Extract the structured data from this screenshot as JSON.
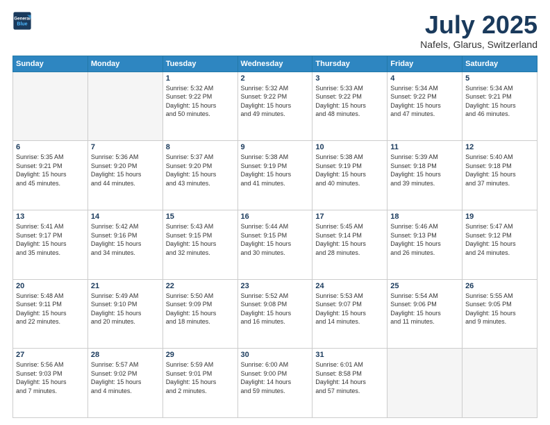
{
  "header": {
    "logo_line1": "General",
    "logo_line2": "Blue",
    "month": "July 2025",
    "location": "Nafels, Glarus, Switzerland"
  },
  "days_of_week": [
    "Sunday",
    "Monday",
    "Tuesday",
    "Wednesday",
    "Thursday",
    "Friday",
    "Saturday"
  ],
  "weeks": [
    [
      {
        "day": "",
        "info": ""
      },
      {
        "day": "",
        "info": ""
      },
      {
        "day": "1",
        "info": "Sunrise: 5:32 AM\nSunset: 9:22 PM\nDaylight: 15 hours\nand 50 minutes."
      },
      {
        "day": "2",
        "info": "Sunrise: 5:32 AM\nSunset: 9:22 PM\nDaylight: 15 hours\nand 49 minutes."
      },
      {
        "day": "3",
        "info": "Sunrise: 5:33 AM\nSunset: 9:22 PM\nDaylight: 15 hours\nand 48 minutes."
      },
      {
        "day": "4",
        "info": "Sunrise: 5:34 AM\nSunset: 9:22 PM\nDaylight: 15 hours\nand 47 minutes."
      },
      {
        "day": "5",
        "info": "Sunrise: 5:34 AM\nSunset: 9:21 PM\nDaylight: 15 hours\nand 46 minutes."
      }
    ],
    [
      {
        "day": "6",
        "info": "Sunrise: 5:35 AM\nSunset: 9:21 PM\nDaylight: 15 hours\nand 45 minutes."
      },
      {
        "day": "7",
        "info": "Sunrise: 5:36 AM\nSunset: 9:20 PM\nDaylight: 15 hours\nand 44 minutes."
      },
      {
        "day": "8",
        "info": "Sunrise: 5:37 AM\nSunset: 9:20 PM\nDaylight: 15 hours\nand 43 minutes."
      },
      {
        "day": "9",
        "info": "Sunrise: 5:38 AM\nSunset: 9:19 PM\nDaylight: 15 hours\nand 41 minutes."
      },
      {
        "day": "10",
        "info": "Sunrise: 5:38 AM\nSunset: 9:19 PM\nDaylight: 15 hours\nand 40 minutes."
      },
      {
        "day": "11",
        "info": "Sunrise: 5:39 AM\nSunset: 9:18 PM\nDaylight: 15 hours\nand 39 minutes."
      },
      {
        "day": "12",
        "info": "Sunrise: 5:40 AM\nSunset: 9:18 PM\nDaylight: 15 hours\nand 37 minutes."
      }
    ],
    [
      {
        "day": "13",
        "info": "Sunrise: 5:41 AM\nSunset: 9:17 PM\nDaylight: 15 hours\nand 35 minutes."
      },
      {
        "day": "14",
        "info": "Sunrise: 5:42 AM\nSunset: 9:16 PM\nDaylight: 15 hours\nand 34 minutes."
      },
      {
        "day": "15",
        "info": "Sunrise: 5:43 AM\nSunset: 9:15 PM\nDaylight: 15 hours\nand 32 minutes."
      },
      {
        "day": "16",
        "info": "Sunrise: 5:44 AM\nSunset: 9:15 PM\nDaylight: 15 hours\nand 30 minutes."
      },
      {
        "day": "17",
        "info": "Sunrise: 5:45 AM\nSunset: 9:14 PM\nDaylight: 15 hours\nand 28 minutes."
      },
      {
        "day": "18",
        "info": "Sunrise: 5:46 AM\nSunset: 9:13 PM\nDaylight: 15 hours\nand 26 minutes."
      },
      {
        "day": "19",
        "info": "Sunrise: 5:47 AM\nSunset: 9:12 PM\nDaylight: 15 hours\nand 24 minutes."
      }
    ],
    [
      {
        "day": "20",
        "info": "Sunrise: 5:48 AM\nSunset: 9:11 PM\nDaylight: 15 hours\nand 22 minutes."
      },
      {
        "day": "21",
        "info": "Sunrise: 5:49 AM\nSunset: 9:10 PM\nDaylight: 15 hours\nand 20 minutes."
      },
      {
        "day": "22",
        "info": "Sunrise: 5:50 AM\nSunset: 9:09 PM\nDaylight: 15 hours\nand 18 minutes."
      },
      {
        "day": "23",
        "info": "Sunrise: 5:52 AM\nSunset: 9:08 PM\nDaylight: 15 hours\nand 16 minutes."
      },
      {
        "day": "24",
        "info": "Sunrise: 5:53 AM\nSunset: 9:07 PM\nDaylight: 15 hours\nand 14 minutes."
      },
      {
        "day": "25",
        "info": "Sunrise: 5:54 AM\nSunset: 9:06 PM\nDaylight: 15 hours\nand 11 minutes."
      },
      {
        "day": "26",
        "info": "Sunrise: 5:55 AM\nSunset: 9:05 PM\nDaylight: 15 hours\nand 9 minutes."
      }
    ],
    [
      {
        "day": "27",
        "info": "Sunrise: 5:56 AM\nSunset: 9:03 PM\nDaylight: 15 hours\nand 7 minutes."
      },
      {
        "day": "28",
        "info": "Sunrise: 5:57 AM\nSunset: 9:02 PM\nDaylight: 15 hours\nand 4 minutes."
      },
      {
        "day": "29",
        "info": "Sunrise: 5:59 AM\nSunset: 9:01 PM\nDaylight: 15 hours\nand 2 minutes."
      },
      {
        "day": "30",
        "info": "Sunrise: 6:00 AM\nSunset: 9:00 PM\nDaylight: 14 hours\nand 59 minutes."
      },
      {
        "day": "31",
        "info": "Sunrise: 6:01 AM\nSunset: 8:58 PM\nDaylight: 14 hours\nand 57 minutes."
      },
      {
        "day": "",
        "info": ""
      },
      {
        "day": "",
        "info": ""
      }
    ]
  ]
}
